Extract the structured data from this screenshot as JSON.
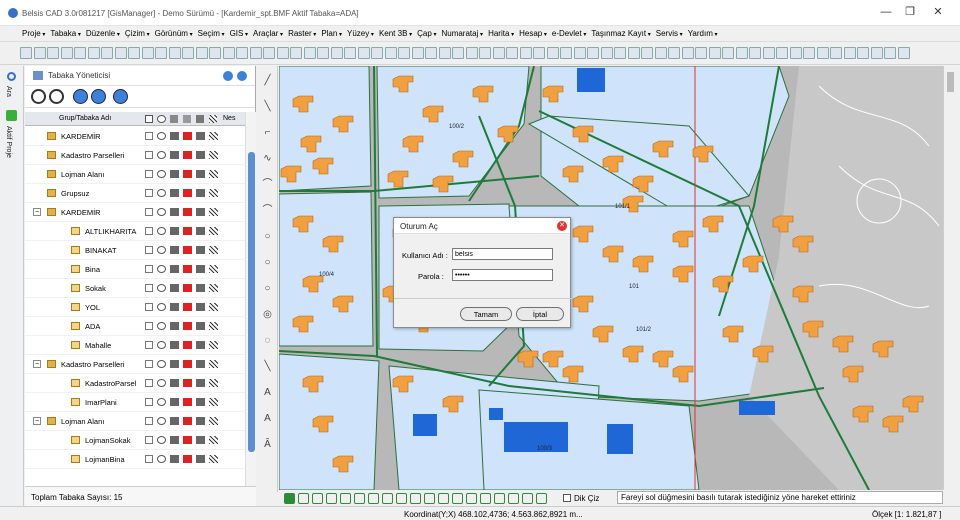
{
  "app": {
    "title": "Belsis CAD 3.0r081217 [GisManager] - Demo Sürümü - [Kardemir_spt.BMF  Aktif Tabaka=ADA]",
    "window_controls": [
      "—",
      "❐",
      "✕"
    ]
  },
  "menu": [
    "Proje",
    "Tabaka",
    "Düzenle",
    "Çizim",
    "Görünüm",
    "Seçim",
    "GIS",
    "Araçlar",
    "Raster",
    "Plan",
    "Yüzey",
    "Kent 3B",
    "Çap",
    "Numarataj",
    "Harita",
    "Hesap",
    "e-Devlet",
    "Taşınmaz Kayıt",
    "Servis",
    "Yardım"
  ],
  "left_tabs": [
    "Ara",
    "Aktif Proje"
  ],
  "panel": {
    "title": "Tabaka Yöneticisi",
    "columns": [
      "Grup/Tabaka Adı",
      "Nes"
    ],
    "rows": [
      {
        "name": "KARDEMİR",
        "kind": "group"
      },
      {
        "name": "Kadastro Parselleri",
        "kind": "group"
      },
      {
        "name": "Lojman Alanı",
        "kind": "group"
      },
      {
        "name": "Grupsuz",
        "kind": "group"
      },
      {
        "name": "KARDEMİR",
        "kind": "group-open"
      },
      {
        "name": "ALTLIKHARITA",
        "kind": "layer"
      },
      {
        "name": "BINAKAT",
        "kind": "layer"
      },
      {
        "name": "Bina",
        "kind": "layer"
      },
      {
        "name": "Sokak",
        "kind": "layer"
      },
      {
        "name": "YOL",
        "kind": "layer"
      },
      {
        "name": "ADA",
        "kind": "layer"
      },
      {
        "name": "Mahalle",
        "kind": "layer"
      },
      {
        "name": "Kadastro Parselleri",
        "kind": "group-open"
      },
      {
        "name": "KadastroParsel",
        "kind": "layer"
      },
      {
        "name": "ImarPlani",
        "kind": "layer"
      },
      {
        "name": "Lojman Alanı",
        "kind": "group-open"
      },
      {
        "name": "LojmanSokak",
        "kind": "layer"
      },
      {
        "name": "LojmanBina",
        "kind": "layer"
      }
    ],
    "footer": "Toplam Tabaka Sayısı: 15"
  },
  "map": {
    "labels": [
      "100/2",
      "101/1",
      "100/4",
      "101",
      "101/2",
      "100/3"
    ]
  },
  "dialog": {
    "title": "Oturum Aç",
    "username_label": "Kullanıcı Adı :",
    "username_value": "belsis",
    "password_label": "Parola :",
    "password_value": "••••••",
    "ok_label": "Tamam",
    "cancel_label": "İptal"
  },
  "bottom": {
    "dik_ciz_label": "Dik Çiz",
    "hint": "Fareyi sol düğmesini basılı tutarak istediğiniz yöne hareket ettiriniz"
  },
  "status": {
    "coordinates": "Koordinat(Y;X)  468.102,4736; 4.563.862,8921 m...",
    "scale": "Ölçek [1: 1.821,87 ]"
  },
  "colors": {
    "building": "#f0a040",
    "parcel": "#cfe4fa",
    "road_line": "#1e7b3a",
    "water_block": "#1f66d6",
    "accent": "#3d82d6"
  }
}
